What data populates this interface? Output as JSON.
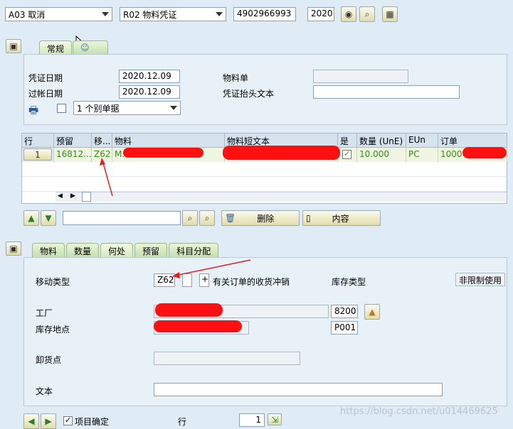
{
  "toolbar": {
    "action": "A03 取消",
    "reference": "R02 物料凭证",
    "doc_number": "4902966993",
    "year": "2020"
  },
  "header_tabs": [
    "常规"
  ],
  "header": {
    "doc_date_label": "凭证日期",
    "doc_date": "2020.12.09",
    "post_date_label": "过帐日期",
    "post_date": "2020.12.09",
    "material_slip_label": "物料单",
    "header_text_label": "凭证抬头文本",
    "print_option": "1 个别单据"
  },
  "grid": {
    "columns": [
      "行",
      "预留",
      "移...",
      "物料",
      "物料短文本",
      "是",
      "数量 (UnE)",
      "EUn",
      "订单"
    ],
    "row": {
      "line": "1",
      "reservation": "16812...",
      "movement": "Z62",
      "material": "M.",
      "short_text": "",
      "checked": true,
      "qty": "10.000",
      "unit": "PC",
      "order": "1000"
    }
  },
  "grid_buttons": {
    "delete": "删除",
    "content": "内容"
  },
  "detail_tabs": [
    "物料",
    "数量",
    "何处",
    "预留",
    "科目分配"
  ],
  "detail": {
    "move_type_label": "移动类型",
    "move_type": "Z62",
    "plus": "+",
    "receipt_reversal": "有关订单的收货冲销",
    "stock_type_label": "库存类型",
    "stock_type": "非限制使用",
    "plant_label": "工厂",
    "plant": "8200",
    "sloc_label": "库存地点",
    "sloc": "P001",
    "unload_label": "卸货点",
    "text_label": "文本"
  },
  "footer": {
    "item_ok": "项目确定",
    "line_label": "行",
    "line_value": "1"
  },
  "watermark": "https://blog.csdn.net/u014469625",
  "colors": {
    "green_text": "#3a8a1a",
    "redaction": "#ff1010",
    "arrow": "#e02020"
  }
}
